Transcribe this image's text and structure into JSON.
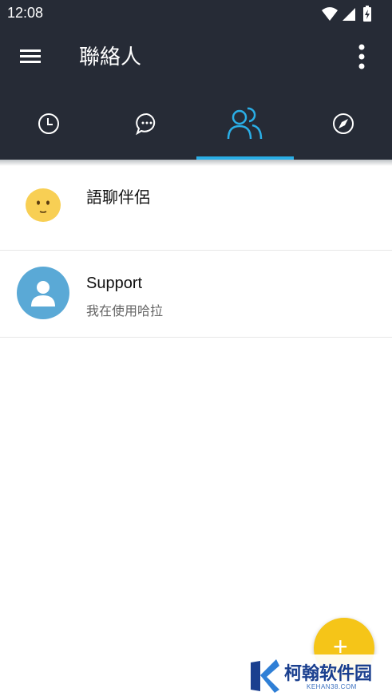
{
  "status_bar": {
    "time": "12:08",
    "icons": [
      "wifi-icon",
      "signal-icon",
      "battery-charging-icon"
    ]
  },
  "app_bar": {
    "title": "聯絡人",
    "menu_icon": "hamburger-icon",
    "more_icon": "more-vert-icon"
  },
  "tabs": [
    {
      "icon": "clock-icon",
      "active": false
    },
    {
      "icon": "chat-bubble-icon",
      "active": false
    },
    {
      "icon": "contacts-icon",
      "active": true
    },
    {
      "icon": "compass-icon",
      "active": false
    }
  ],
  "contacts": [
    {
      "name": "語聊伴侶",
      "status": "",
      "avatar": "smiley-face-icon"
    },
    {
      "name": "Support",
      "status": "我在使用哈拉",
      "avatar": "person-icon"
    }
  ],
  "fab": {
    "label": "+"
  },
  "watermark": {
    "text": "柯翰软件园",
    "sub": "KEHAN38.COM"
  },
  "colors": {
    "bar": "#262b36",
    "accent": "#2aaee6",
    "fab": "#f5c518",
    "avatar_blue": "#5aa9d6"
  }
}
